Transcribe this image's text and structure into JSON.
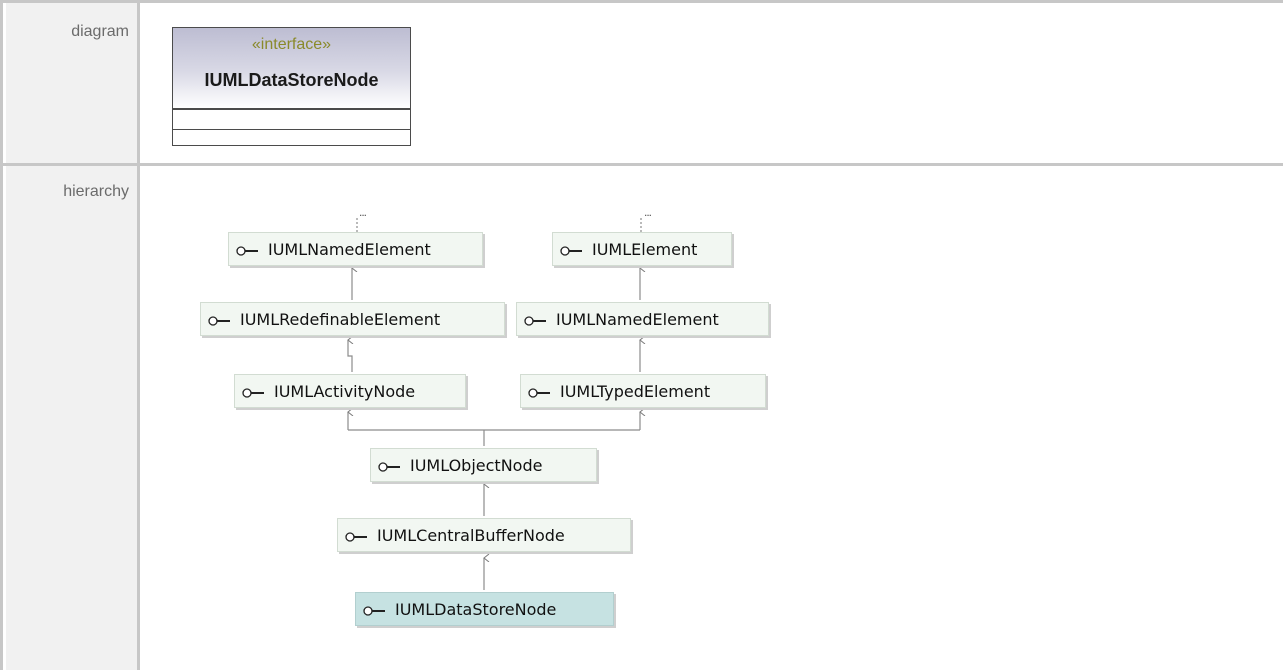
{
  "rows": {
    "diagram_label": "diagram",
    "hierarchy_label": "hierarchy"
  },
  "interface": {
    "stereotype": "«interface»",
    "name": "IUMLDataStoreNode"
  },
  "hierarchy": {
    "ellipsis": "...",
    "nodes": [
      {
        "label": "IUMLNamedElement"
      },
      {
        "label": "IUMLElement"
      },
      {
        "label": "IUMLRedefinableElement"
      },
      {
        "label": "IUMLNamedElement"
      },
      {
        "label": "IUMLActivityNode"
      },
      {
        "label": "IUMLTypedElement"
      },
      {
        "label": "IUMLObjectNode"
      },
      {
        "label": "IUMLCentralBufferNode"
      },
      {
        "label": "IUMLDataStoreNode",
        "current": true
      }
    ]
  },
  "colors": {
    "grid": "#c7c7c7",
    "label_bg": "#f1f1f1",
    "node_bg": "#f2f7f2",
    "current_node_bg": "#c6e2e2",
    "stereotype": "#8a8a2a"
  }
}
